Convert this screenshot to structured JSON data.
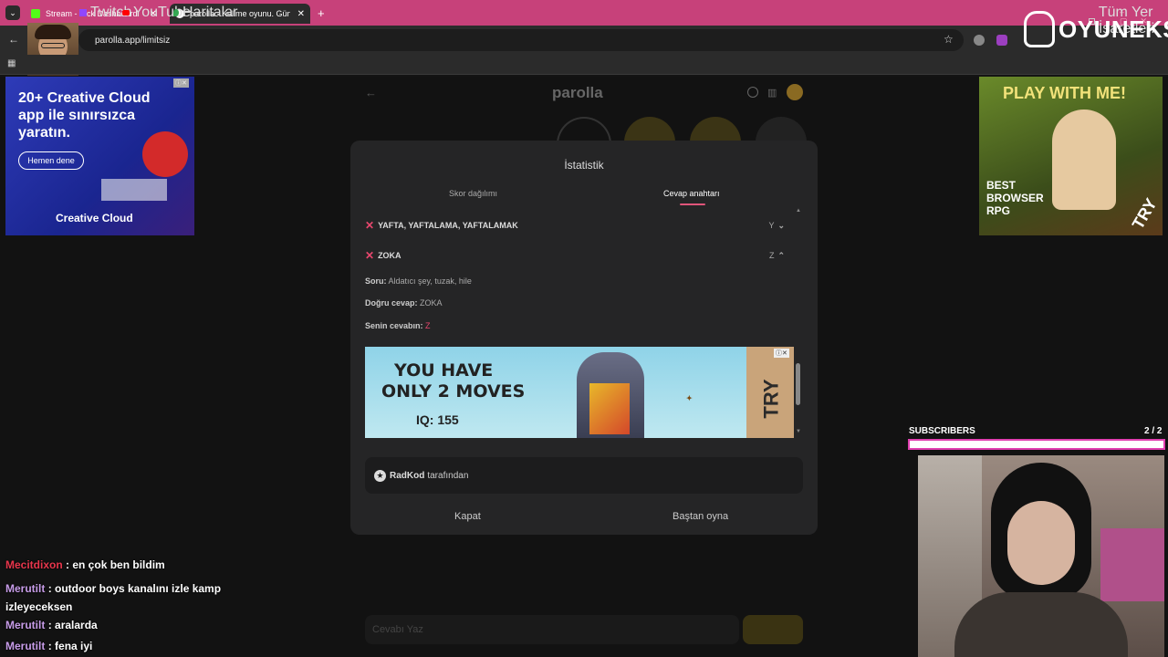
{
  "browser": {
    "tabs": [
      {
        "label": "Stream - Kick Dashboard"
      },
      {
        "label": "parolla - Kelime oyunu. Günlük"
      }
    ],
    "url": "parolla.app/limitsiz",
    "bookmarks": [
      "Twitch",
      "YouTube",
      "Haritalar"
    ],
    "all_bookmarks": "Tüm Yer İşaretleri"
  },
  "site": {
    "title": "parolla"
  },
  "ads": {
    "left": {
      "headline": "20+ Creative Cloud app ile sınırsızca yaratın.",
      "button": "Hemen dene",
      "brand": "Creative Cloud"
    },
    "right": {
      "headline": "PLAY WITH ME!",
      "tag": "BEST BROWSER RPG",
      "try": "TRY"
    },
    "inline": {
      "line1": "YOU HAVE",
      "line2": "ONLY 2 MOVES",
      "iq": "IQ: 155",
      "try": "TRY"
    }
  },
  "modal": {
    "title": "İstatistik",
    "tabs": [
      "Skor dağılımı",
      "Cevap anahtarı"
    ],
    "rows": [
      {
        "answer": "YAFTA, YAFTALAMA, YAFTALAMAK",
        "letter": "Y"
      },
      {
        "answer": "ZOKA",
        "letter": "Z"
      }
    ],
    "detail": {
      "question_label": "Soru:",
      "question": "Aldatıcı şey, tuzak, hile",
      "correct_label": "Doğru cevap:",
      "correct": "ZOKA",
      "yours_label": "Senin cevabın:",
      "yours": "Z"
    },
    "credit_name": "RadKod",
    "credit_suffix": "tarafından",
    "close": "Kapat",
    "restart": "Baştan oyna"
  },
  "input_placeholder": "Cevabı Yaz",
  "overlay": {
    "logo": "OYUNEKS",
    "subscribers_label": "SUBSCRIBERS",
    "subscribers_count": "2 / 2",
    "chat": [
      {
        "user": "Mecitdixon",
        "text": ": en çok ben bildim",
        "color": "#e8364c"
      },
      {
        "user": "Merutilt",
        "text": ": outdoor boys kanalını izle kamp izleyeceksen",
        "color": "#c79ce8"
      },
      {
        "user": "Merutilt",
        "text": ": aralarda",
        "color": "#c79ce8"
      },
      {
        "user": "Merutilt",
        "text": ": fena iyi",
        "color": "#c79ce8"
      }
    ]
  },
  "colors": {
    "accent": "#e0557a",
    "chrome": "#c7417a",
    "cross": "#e8476e"
  }
}
